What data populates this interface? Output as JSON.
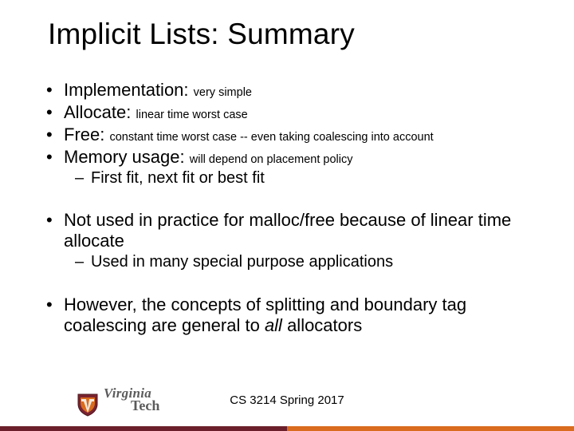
{
  "title": "Implicit Lists: Summary",
  "items": [
    {
      "label": "Implementation:",
      "detail": "very simple"
    },
    {
      "label": "Allocate:",
      "detail": "linear time worst case"
    },
    {
      "label": "Free:",
      "detail": "constant time worst case -- even taking coalescing into account"
    },
    {
      "label": "Memory usage:",
      "detail": "will depend on placement policy"
    }
  ],
  "sub1": "First fit, next fit or best fit",
  "item5": "Not used in practice for malloc/free because of linear time allocate",
  "sub2": "Used in many special purpose applications",
  "item6_a": "However, the concepts of splitting and boundary tag coalescing are general to ",
  "item6_b": "all",
  "item6_c": " allocators",
  "footer": "CS 3214 Spring 2017",
  "logo": {
    "line1": "Virginia",
    "line2": "Tech"
  }
}
